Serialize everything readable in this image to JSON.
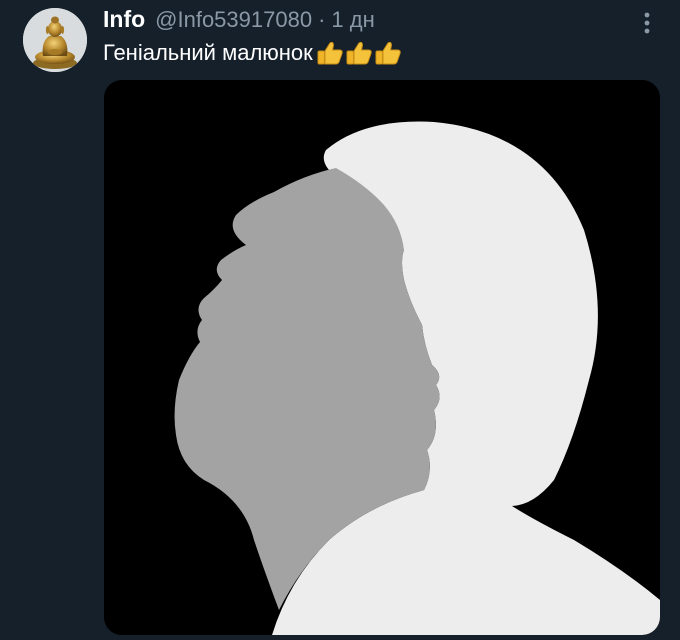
{
  "tweet": {
    "author": {
      "display_name": "Info",
      "handle": "@Info53917080",
      "avatar_icon": "golden-buddha-statue"
    },
    "separator": "·",
    "time": "1 дн",
    "more_icon": "vertical-ellipsis-icon",
    "text": "Геніальний малюнок",
    "emojis": [
      "👍",
      "👍",
      "👍"
    ],
    "media": {
      "description_icon": "optical-illusion-two-profiles",
      "colors": {
        "background": "#000000",
        "gray_profile": "#a3a3a3",
        "white_profile": "#ededed"
      }
    }
  },
  "colors": {
    "page_background": "#15202b",
    "primary_text": "#ffffff",
    "secondary_text": "#8b98a5"
  }
}
